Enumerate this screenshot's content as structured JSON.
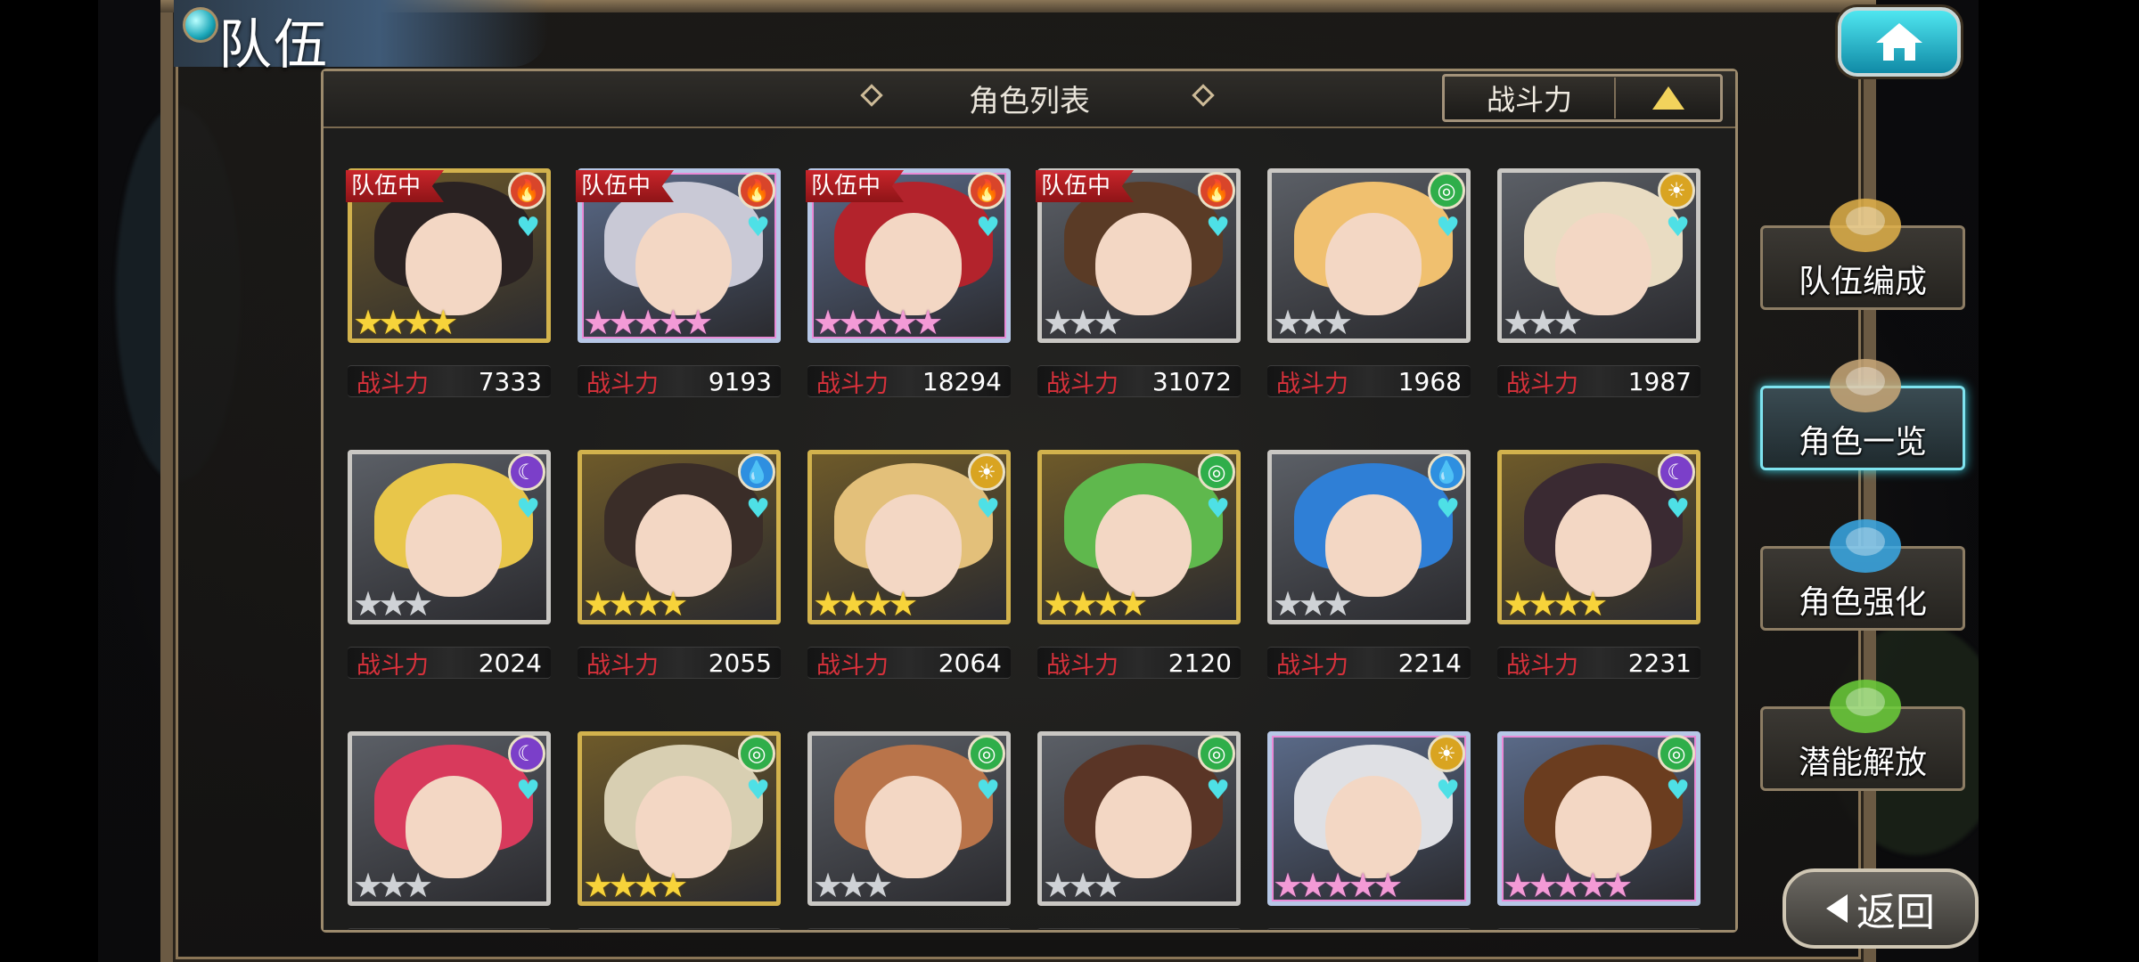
{
  "screen": {
    "title": "队伍",
    "panel_title": "角色列表",
    "sort_label": "战斗力",
    "power_label": "战斗力"
  },
  "side_menu": [
    {
      "label": "队伍编成",
      "active": false
    },
    {
      "label": "角色一览",
      "active": true
    },
    {
      "label": "角色强化",
      "active": false
    },
    {
      "label": "潜能解放",
      "active": false
    }
  ],
  "back_label": "返回",
  "badge_text": "队伍中",
  "characters": [
    {
      "element": "fire",
      "frame": "gold",
      "stars": 4,
      "star_style": "gold",
      "in_team": true,
      "power": "7333",
      "hair": "#2a2222"
    },
    {
      "element": "fire",
      "frame": "rainbow",
      "stars": 5,
      "star_style": "rainbow",
      "in_team": true,
      "power": "9193",
      "hair": "#c9c9d6"
    },
    {
      "element": "fire",
      "frame": "rainbow",
      "stars": 5,
      "star_style": "rainbow",
      "in_team": true,
      "power": "18294",
      "hair": "#b3232c"
    },
    {
      "element": "fire",
      "frame": "silver",
      "stars": 3,
      "star_style": "silver",
      "in_team": true,
      "power": "31072",
      "hair": "#5a3b26"
    },
    {
      "element": "wind",
      "frame": "silver",
      "stars": 3,
      "star_style": "silver",
      "in_team": false,
      "power": "1968",
      "hair": "#f0c06f"
    },
    {
      "element": "light",
      "frame": "silver",
      "stars": 3,
      "star_style": "silver",
      "in_team": false,
      "power": "1987",
      "hair": "#e9dcc2"
    },
    {
      "element": "dark",
      "frame": "silver",
      "stars": 3,
      "star_style": "silver",
      "in_team": false,
      "power": "2024",
      "hair": "#e8c64a"
    },
    {
      "element": "water",
      "frame": "gold",
      "stars": 4,
      "star_style": "gold",
      "in_team": false,
      "power": "2055",
      "hair": "#3a2d28"
    },
    {
      "element": "light",
      "frame": "gold",
      "stars": 4,
      "star_style": "gold",
      "in_team": false,
      "power": "2064",
      "hair": "#e3c07a"
    },
    {
      "element": "wind",
      "frame": "gold",
      "stars": 4,
      "star_style": "gold",
      "in_team": false,
      "power": "2120",
      "hair": "#5fb84d"
    },
    {
      "element": "water",
      "frame": "silver",
      "stars": 3,
      "star_style": "silver",
      "in_team": false,
      "power": "2214",
      "hair": "#2f7fd6"
    },
    {
      "element": "dark",
      "frame": "gold",
      "stars": 4,
      "star_style": "gold",
      "in_team": false,
      "power": "2231",
      "hair": "#3a2a32"
    },
    {
      "element": "dark",
      "frame": "silver",
      "stars": 3,
      "star_style": "silver",
      "in_team": false,
      "power": "",
      "hair": "#d83a5c"
    },
    {
      "element": "wind",
      "frame": "gold",
      "stars": 4,
      "star_style": "gold",
      "in_team": false,
      "power": "",
      "hair": "#d8cfb2"
    },
    {
      "element": "wind",
      "frame": "silver",
      "stars": 3,
      "star_style": "silver",
      "in_team": false,
      "power": "",
      "hair": "#b9744a"
    },
    {
      "element": "wind",
      "frame": "silver",
      "stars": 3,
      "star_style": "silver",
      "in_team": false,
      "power": "",
      "hair": "#5a3526"
    },
    {
      "element": "light",
      "frame": "rainbow",
      "stars": 5,
      "star_style": "rainbow",
      "in_team": false,
      "power": "",
      "hair": "#dfe0e4"
    },
    {
      "element": "wind",
      "frame": "rainbow",
      "stars": 5,
      "star_style": "rainbow",
      "in_team": false,
      "power": "",
      "hair": "#6b3d1f"
    }
  ],
  "element_colors": {
    "fire": "#d9452a",
    "water": "#2e8fe0",
    "wind": "#2fae4a",
    "light": "#d9a421",
    "dark": "#7b3fc9"
  },
  "element_icons": {
    "fire": "fire-icon",
    "water": "water-drop-icon",
    "wind": "wind-swirl-icon",
    "light": "sun-icon",
    "dark": "moon-icon"
  }
}
